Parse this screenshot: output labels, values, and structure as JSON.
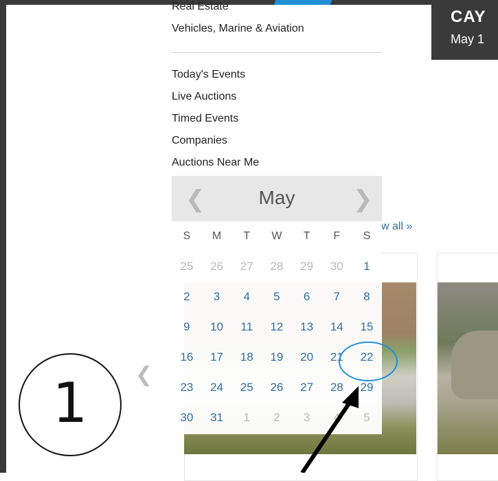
{
  "menu": {
    "categories": [
      "Real Estate",
      "Vehicles, Marine & Aviation"
    ],
    "links": [
      "Today's Events",
      "Live Auctions",
      "Timed Events",
      "Companies",
      "Auctions Near Me"
    ]
  },
  "banner": {
    "title": "CAY",
    "date": "May 1"
  },
  "view_all": "w all »",
  "calendar": {
    "month": "May",
    "weekdays": [
      "S",
      "M",
      "T",
      "W",
      "T",
      "F",
      "S"
    ],
    "weeks": [
      [
        {
          "d": "25",
          "out": true
        },
        {
          "d": "26",
          "out": true
        },
        {
          "d": "27",
          "out": true
        },
        {
          "d": "28",
          "out": true
        },
        {
          "d": "29",
          "out": true
        },
        {
          "d": "30",
          "out": true
        },
        {
          "d": "1",
          "out": false
        }
      ],
      [
        {
          "d": "2",
          "out": false
        },
        {
          "d": "3",
          "out": false
        },
        {
          "d": "4",
          "out": false
        },
        {
          "d": "5",
          "out": false
        },
        {
          "d": "6",
          "out": false
        },
        {
          "d": "7",
          "out": false
        },
        {
          "d": "8",
          "out": false
        }
      ],
      [
        {
          "d": "9",
          "out": false
        },
        {
          "d": "10",
          "out": false
        },
        {
          "d": "11",
          "out": false
        },
        {
          "d": "12",
          "out": false
        },
        {
          "d": "13",
          "out": false
        },
        {
          "d": "14",
          "out": false
        },
        {
          "d": "15",
          "out": false
        }
      ],
      [
        {
          "d": "16",
          "out": false
        },
        {
          "d": "17",
          "out": false
        },
        {
          "d": "18",
          "out": false
        },
        {
          "d": "19",
          "out": false
        },
        {
          "d": "20",
          "out": false
        },
        {
          "d": "21",
          "out": false
        },
        {
          "d": "22",
          "out": false
        }
      ],
      [
        {
          "d": "23",
          "out": false
        },
        {
          "d": "24",
          "out": false
        },
        {
          "d": "25",
          "out": false
        },
        {
          "d": "26",
          "out": false
        },
        {
          "d": "27",
          "out": false
        },
        {
          "d": "28",
          "out": false
        },
        {
          "d": "29",
          "out": false
        }
      ],
      [
        {
          "d": "30",
          "out": false
        },
        {
          "d": "31",
          "out": false
        },
        {
          "d": "1",
          "out": true
        },
        {
          "d": "2",
          "out": true
        },
        {
          "d": "3",
          "out": true
        },
        {
          "d": "4",
          "out": true
        },
        {
          "d": "5",
          "out": true
        }
      ]
    ]
  },
  "annotation": {
    "step": "1",
    "highlight_color": "#1f8fd8"
  },
  "colors": {
    "accent": "#1f8fd8",
    "link": "#2f6fa3",
    "frame": "#3a3a3a"
  },
  "icons": {
    "prev": "chevron-left-icon",
    "next": "chevron-right-icon"
  }
}
